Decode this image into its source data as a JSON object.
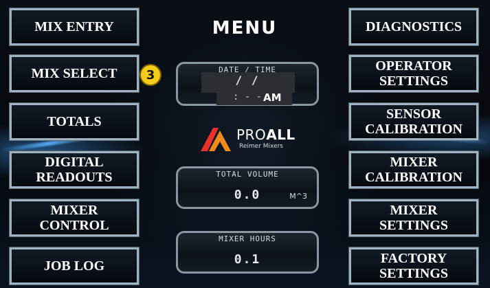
{
  "menu": {
    "title": "MENU"
  },
  "left_buttons": [
    {
      "label": "MIX ENTRY"
    },
    {
      "label": "MIX SELECT"
    },
    {
      "label": "TOTALS"
    },
    {
      "label": "DIGITAL\nREADOUTS"
    },
    {
      "label": "MIXER\nCONTROL"
    },
    {
      "label": "JOB LOG"
    }
  ],
  "right_buttons": [
    {
      "label": "DIAGNOSTICS"
    },
    {
      "label": "OPERATOR\nSETTINGS"
    },
    {
      "label": "SENSOR\nCALIBRATION"
    },
    {
      "label": "MIXER\nCALIBRATION"
    },
    {
      "label": "MIXER\nSETTINGS"
    },
    {
      "label": "FACTORY\nSETTINGS"
    }
  ],
  "badge": {
    "value": "3"
  },
  "date_time": {
    "label": "DATE / TIME",
    "date": "/    /",
    "time": ": - -",
    "ampm": "AM"
  },
  "logo": {
    "brand_regular": "PRO",
    "brand_bold": "ALL",
    "tagline": "Reimer Mixers"
  },
  "total_volume": {
    "label": "TOTAL VOLUME",
    "value": "0.0",
    "unit": "M^3"
  },
  "mixer_hours": {
    "label": "MIXER HOURS",
    "value": "0.1"
  },
  "colors": {
    "badge": "#f5cc18",
    "logo_red": "#e8322b",
    "logo_orange": "#f08a1c",
    "accent_blue": "#5ab4ff"
  }
}
